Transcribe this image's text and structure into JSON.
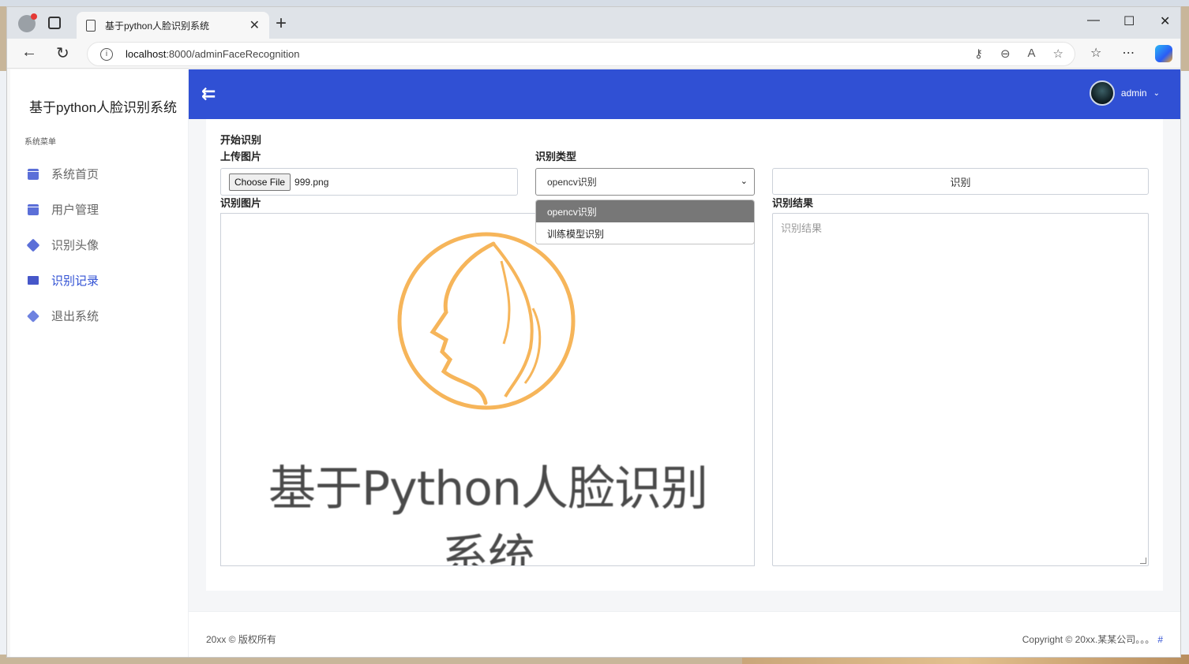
{
  "browser": {
    "tab_title": "基于python人脸识别系统",
    "url_host": "localhost",
    "url_path": ":8000/adminFaceRecognition"
  },
  "sidebar": {
    "brand": "基于python人脸识别系统",
    "caption": "系统菜单",
    "items": [
      {
        "label": "系统首页",
        "icon": "calendar-icon"
      },
      {
        "label": "用户管理",
        "icon": "calendar-icon"
      },
      {
        "label": "识别头像",
        "icon": "cube-icon"
      },
      {
        "label": "识别记录",
        "icon": "screen-icon",
        "active": true
      },
      {
        "label": "退出系统",
        "icon": "layers-icon"
      }
    ]
  },
  "header": {
    "username": "admin",
    "accent": "#3050d4"
  },
  "form": {
    "title": "开始识别",
    "upload_label": "上传图片",
    "file_button": "Choose File",
    "file_name": "999.png",
    "type_label": "识别类型",
    "type_selected": "opencv识别",
    "type_options": [
      "opencv识别",
      "训练模型识别"
    ],
    "recognize_button": "识别",
    "image_label": "识别图片",
    "result_label": "识别结果",
    "result_placeholder": "识别结果",
    "image_caption": "基于Python人脸识别系统"
  },
  "footer": {
    "left": "20xx © 版权所有",
    "right": "Copyright © 20xx.某某公司。。。",
    "link": "#"
  }
}
